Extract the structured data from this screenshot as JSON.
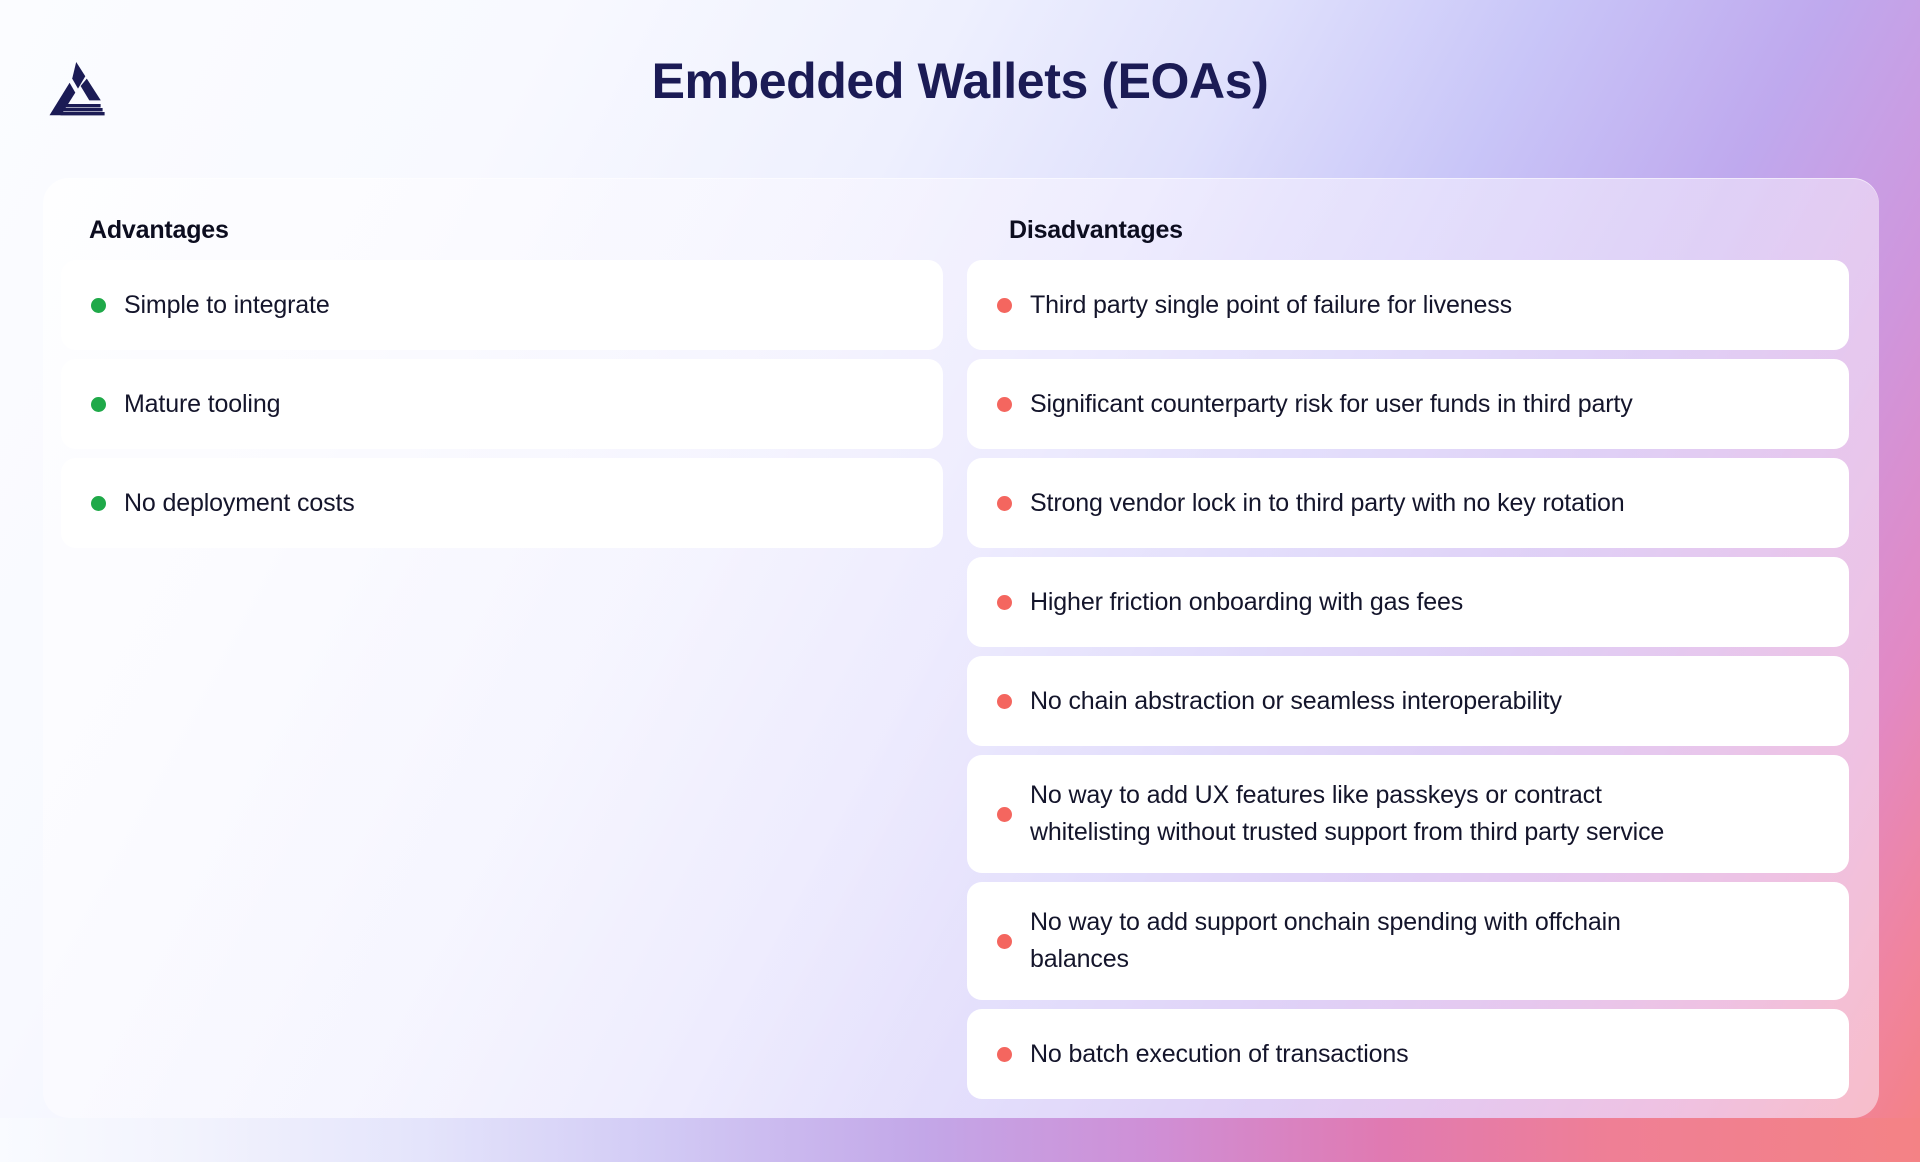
{
  "header": {
    "title": "Embedded Wallets (EOAs)",
    "logo_name": "alchemy-triangle-logo"
  },
  "colors": {
    "title": "#1b1b55",
    "heading": "#0c0d1f",
    "body_text": "#14152b",
    "advantage_bullet": "#1fa949",
    "disadvantage_bullet": "#f4665f",
    "row_background": "#ffffff",
    "background_gradient_start": "#fbfcff",
    "background_gradient_mid": "#bfa9ee",
    "background_gradient_end": "#f58182"
  },
  "columns": {
    "advantages": {
      "heading": "Advantages",
      "items": [
        {
          "lines": [
            "Simple to integrate"
          ]
        },
        {
          "lines": [
            "Mature tooling"
          ]
        },
        {
          "lines": [
            "No deployment costs"
          ]
        }
      ]
    },
    "disadvantages": {
      "heading": "Disadvantages",
      "items": [
        {
          "lines": [
            "Third party single point of failure for liveness"
          ]
        },
        {
          "lines": [
            "Significant counterparty risk for user funds in third party"
          ]
        },
        {
          "lines": [
            "Strong vendor lock in to third party with no key rotation"
          ]
        },
        {
          "lines": [
            "Higher friction onboarding with gas fees"
          ]
        },
        {
          "lines": [
            "No chain abstraction or seamless interoperability"
          ]
        },
        {
          "lines": [
            "No way to add UX features like passkeys or contract",
            "whitelisting without trusted support from third party service"
          ]
        },
        {
          "lines": [
            "No way to add support onchain spending with offchain",
            "balances"
          ]
        },
        {
          "lines": [
            "No batch execution of transactions"
          ]
        }
      ]
    }
  }
}
